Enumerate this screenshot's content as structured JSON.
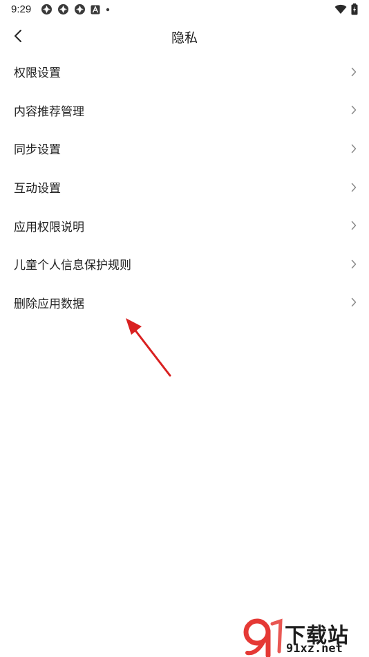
{
  "status_bar": {
    "time": "9:29",
    "left_icons": [
      "app-notification-icon",
      "app-notification-icon",
      "app-notification-icon",
      "a-notification-icon",
      "dot-icon"
    ],
    "right_icons": [
      "wifi-icon",
      "battery-icon"
    ]
  },
  "header": {
    "title": "隐私",
    "back_icon": "chevron-left-icon"
  },
  "menu": {
    "items": [
      {
        "label": "权限设置"
      },
      {
        "label": "内容推荐管理"
      },
      {
        "label": "同步设置"
      },
      {
        "label": "互动设置"
      },
      {
        "label": "应用权限说明"
      },
      {
        "label": "儿童个人信息保护规则"
      },
      {
        "label": "删除应用数据"
      }
    ]
  },
  "annotation": {
    "color": "#d92020"
  },
  "watermark": {
    "title": "下载站",
    "url": "91xz.net",
    "logo_color": "#e53935"
  }
}
